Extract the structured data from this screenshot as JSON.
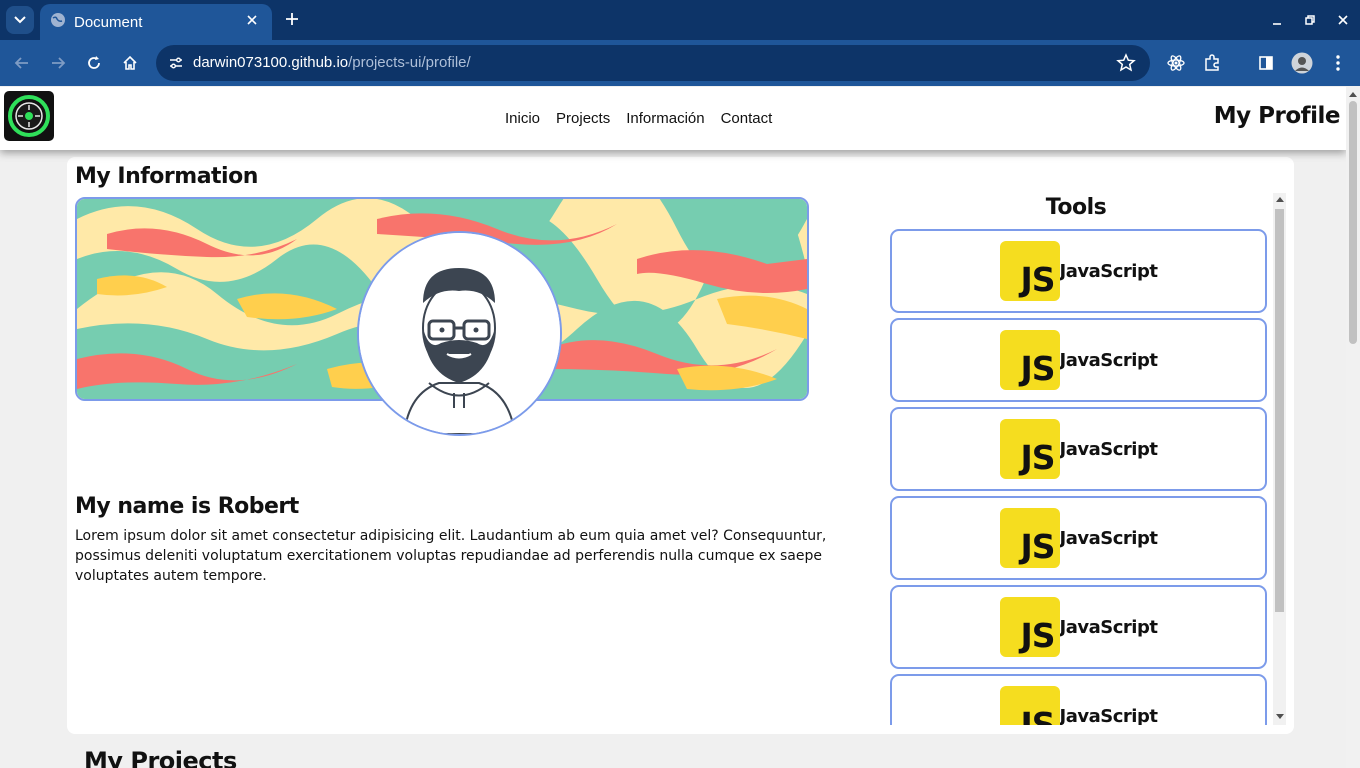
{
  "browser": {
    "tab_title": "Document",
    "url_host": "darwin073100.github.io",
    "url_path": "/projects-ui/profile/",
    "icons": [
      "tab-search-icon",
      "globe-icon",
      "close-icon",
      "plus-icon",
      "minimize-icon",
      "restore-icon",
      "close-window-icon",
      "back-icon",
      "forward-icon",
      "reload-icon",
      "home-icon",
      "site-info-icon",
      "star-icon",
      "react-devtools-icon",
      "extensions-icon",
      "side-panel-icon",
      "profile-avatar",
      "more-menu-icon"
    ]
  },
  "nav": {
    "links": [
      "Inicio",
      "Projects",
      "Información",
      "Contact"
    ],
    "brand": "My Profile"
  },
  "info": {
    "title": "My Information",
    "name_heading": "My name is Robert",
    "bio": "Lorem ipsum dolor sit amet consectetur adipisicing elit. Laudantium ab eum quia amet vel? Consequuntur, possimus deleniti voluptatum exercitationem voluptas repudiandae ad perferendis nulla cumque ex saepe voluptates autem tempore."
  },
  "tools": {
    "title": "Tools",
    "items": [
      {
        "logo": "JS",
        "name": "JavaScript"
      },
      {
        "logo": "JS",
        "name": "JavaScript"
      },
      {
        "logo": "JS",
        "name": "JavaScript"
      },
      {
        "logo": "JS",
        "name": "JavaScript"
      },
      {
        "logo": "JS",
        "name": "JavaScript"
      },
      {
        "logo": "JS",
        "name": "JavaScript"
      }
    ]
  },
  "projects": {
    "title": "My Projects"
  },
  "colors": {
    "chrome_dark": "#0d3468",
    "chrome_mid": "#1f5699",
    "accent_border": "#7c9bea",
    "js_yellow": "#f5dd1f"
  }
}
